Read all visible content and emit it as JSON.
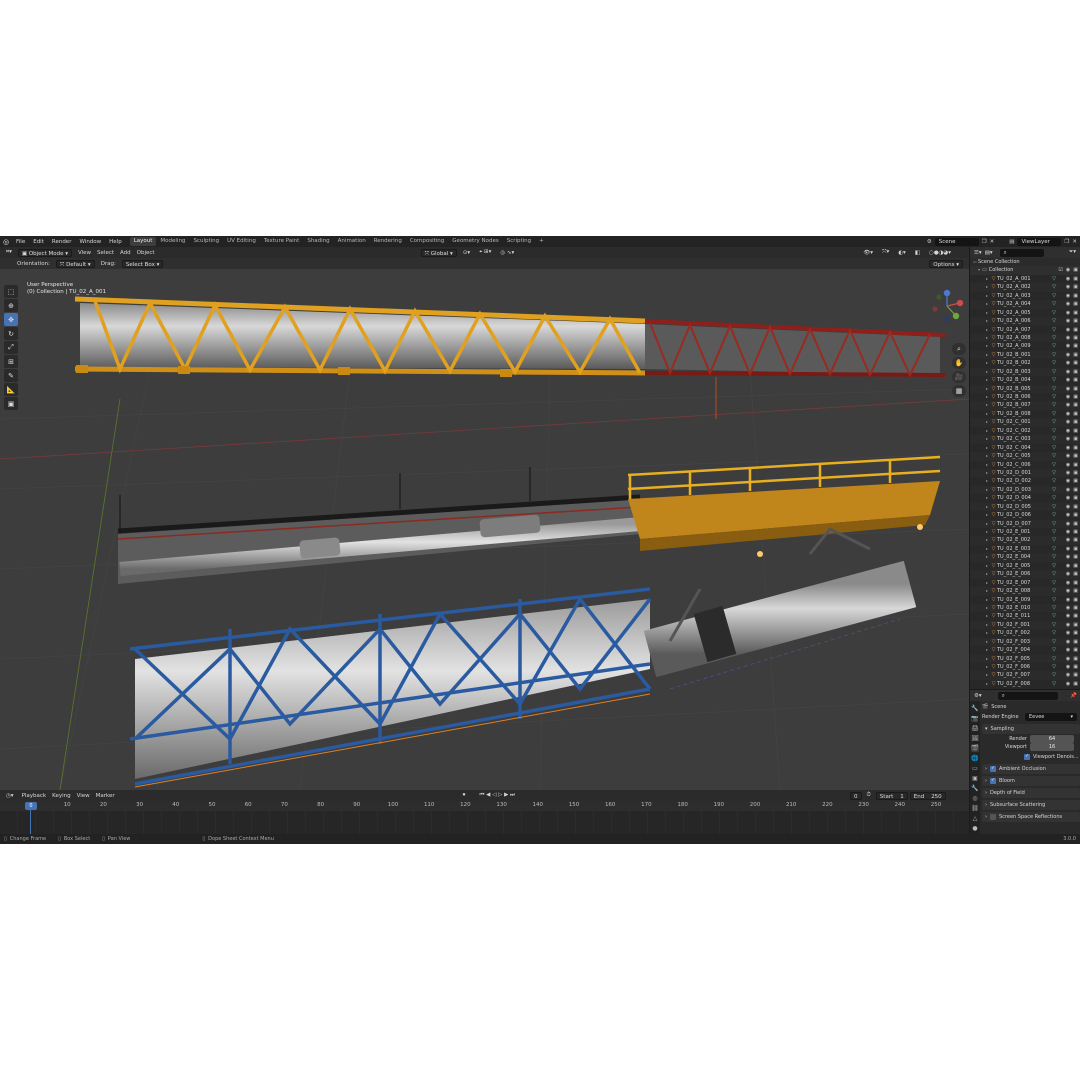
{
  "menu": [
    "File",
    "Edit",
    "Render",
    "Window",
    "Help"
  ],
  "workspaces": [
    "Layout",
    "Modeling",
    "Sculpting",
    "UV Editing",
    "Texture Paint",
    "Shading",
    "Animation",
    "Rendering",
    "Compositing",
    "Geometry Nodes",
    "Scripting"
  ],
  "add_tab": "+",
  "scene_name": "Scene",
  "view_layer": "ViewLayer",
  "viewport": {
    "mode": "Object Mode",
    "menus": [
      "View",
      "Select",
      "Add",
      "Object"
    ],
    "transform_orientation": "Global",
    "orientation_label": "Orientation:",
    "orientation_value": "Default",
    "drag_label": "Drag:",
    "drag_value": "Select Box",
    "options": "Options",
    "info_line1": "User Perspective",
    "info_line2": "(0) Collection | TU_02_A_001"
  },
  "timeline": {
    "menus": [
      "Playback",
      "Keying",
      "View",
      "Marker"
    ],
    "current_frame": "0",
    "start_label": "Start",
    "start": "1",
    "end_label": "End",
    "end": "250",
    "ticks": [
      "10",
      "20",
      "30",
      "40",
      "50",
      "60",
      "70",
      "80",
      "90",
      "100",
      "110",
      "120",
      "130",
      "140",
      "150",
      "160",
      "170",
      "180",
      "190",
      "200",
      "210",
      "220",
      "230",
      "240",
      "250"
    ],
    "playhead": "0"
  },
  "statusbar": {
    "items": [
      "Change Frame",
      "Box Select",
      "Pan View",
      "Dope Sheet Context Menu"
    ],
    "version": "3.0.0"
  },
  "outliner": {
    "root": "Scene Collection",
    "collection": "Collection",
    "objects": [
      "TU_02_A_001",
      "TU_02_A_002",
      "TU_02_A_003",
      "TU_02_A_004",
      "TU_02_A_005",
      "TU_02_A_006",
      "TU_02_A_007",
      "TU_02_A_008",
      "TU_02_A_009",
      "TU_02_B_001",
      "TU_02_B_002",
      "TU_02_B_003",
      "TU_02_B_004",
      "TU_02_B_005",
      "TU_02_B_006",
      "TU_02_B_007",
      "TU_02_B_008",
      "TU_02_C_001",
      "TU_02_C_002",
      "TU_02_C_003",
      "TU_02_C_004",
      "TU_02_C_005",
      "TU_02_C_006",
      "TU_02_D_001",
      "TU_02_D_002",
      "TU_02_D_003",
      "TU_02_D_004",
      "TU_02_D_005",
      "TU_02_D_006",
      "TU_02_D_007",
      "TU_02_E_001",
      "TU_02_E_002",
      "TU_02_E_003",
      "TU_02_E_004",
      "TU_02_E_005",
      "TU_02_E_006",
      "TU_02_E_007",
      "TU_02_E_008",
      "TU_02_E_009",
      "TU_02_E_010",
      "TU_02_E_011",
      "TU_02_F_001",
      "TU_02_F_002",
      "TU_02_F_003",
      "TU_02_F_004",
      "TU_02_F_005",
      "TU_02_F_006",
      "TU_02_F_007",
      "TU_02_F_008"
    ]
  },
  "properties": {
    "context": "Scene",
    "render_engine_label": "Render Engine",
    "render_engine": "Eevee",
    "sampling": "Sampling",
    "render_label": "Render",
    "render_samples": "64",
    "viewport_label": "Viewport",
    "viewport_samples": "16",
    "viewport_denoise": "Viewport Denois...",
    "panels": [
      {
        "label": "Ambient Occlusion",
        "checked": true
      },
      {
        "label": "Bloom",
        "checked": true
      },
      {
        "label": "Depth of Field",
        "checked": null
      },
      {
        "label": "Subsurface Scattering",
        "checked": null
      },
      {
        "label": "Screen Space Reflections",
        "checked": false
      }
    ]
  },
  "colors": {
    "accent": "#4772b3",
    "truss_yellow": "#e0a020",
    "truss_red": "#8f1f1a",
    "truss_blue": "#2a5aa0",
    "object_icon": "#e89a4a"
  }
}
